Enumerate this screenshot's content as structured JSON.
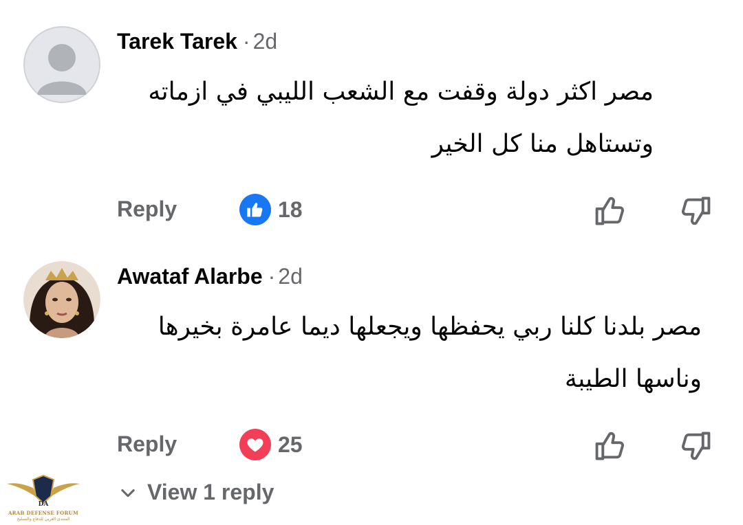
{
  "comments": [
    {
      "author": "Tarek Tarek",
      "separator": "·",
      "age": "2d",
      "avatar_icon": "default-user-icon",
      "text_lines": [
        "مصر اكثر دولة وقفت مع الشعب الليبي في ازماته",
        "وتستاهل منا كل الخير"
      ],
      "reply_label": "Reply",
      "reaction": "like",
      "reaction_count": "18"
    },
    {
      "author": "Awataf Alarbe",
      "separator": "·",
      "age": "2d",
      "avatar_icon": "user-photo",
      "text_lines": [
        "مصر بلدنا كلنا ربي يحفظها ويجعلها ديما عامرة بخيرها",
        "وناسها الطيبة"
      ],
      "reply_label": "Reply",
      "reaction": "love",
      "reaction_count": "25"
    }
  ],
  "view_replies_label": "View 1 reply",
  "colors": {
    "like": "#1877f2",
    "love": "#f33e58",
    "muted": "#65676b"
  },
  "watermark": {
    "title": "ARAB DEFENSE FORUM",
    "subtitle": "المنتدى العربي للدفاع والتسليح",
    "monogram": "DA"
  }
}
